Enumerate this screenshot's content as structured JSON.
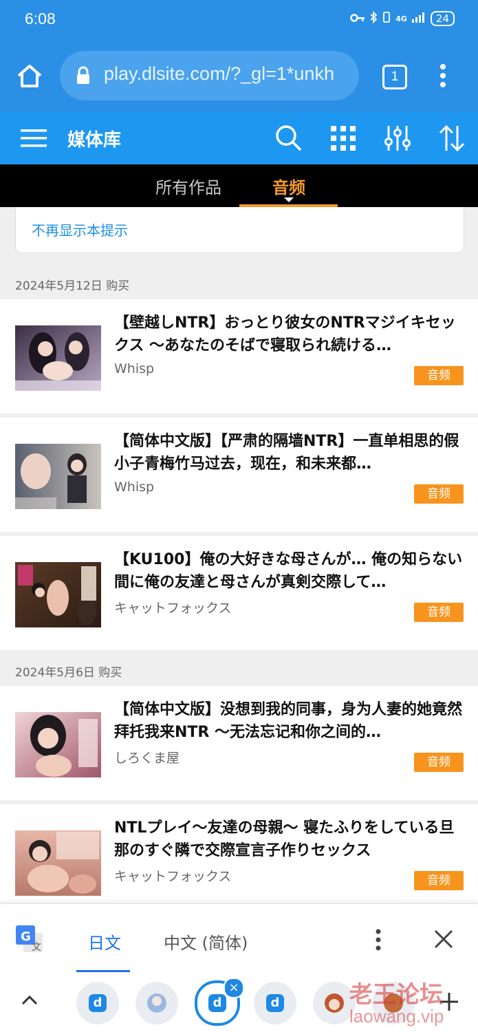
{
  "status_bar": {
    "time": "6:08",
    "network": "4G",
    "battery": "24"
  },
  "address_bar": {
    "url": "play.dlsite.com/?_gl=1*unkh",
    "tab_count": "1"
  },
  "toolbar": {
    "title": "媒体库"
  },
  "tabs": [
    {
      "label": "所有作品",
      "active": false
    },
    {
      "label": "音频",
      "active": true
    }
  ],
  "notice": {
    "link_text": "不再显示本提示"
  },
  "groups": [
    {
      "date": "2024年5月12日 购买",
      "items": [
        {
          "title": "【壁越しNTR】おっとり彼女のNTRマジイキセックス ～あなたのそばで寝取られ続ける…",
          "author": "Whisp",
          "badge": "音频"
        },
        {
          "title": "【简体中文版】【严肃的隔墙NTR】一直单相思的假小子青梅竹马过去，现在，和未来都…",
          "author": "Whisp",
          "badge": "音频"
        },
        {
          "title": "【KU100】俺の大好きな母さんが… 俺の知らない間に俺の友達と母さんが真剣交際して…",
          "author": "キャットフォックス",
          "badge": "音频"
        }
      ]
    },
    {
      "date": "2024年5月6日 购买",
      "items": [
        {
          "title": "【简体中文版】没想到我的同事，身为人妻的她竟然拜托我来NTR ～无法忘记和你之间的…",
          "author": "しろくま屋",
          "badge": "音频"
        },
        {
          "title": "NTLプレイ～友達の母親～ 寝たふりをしている旦那のすぐ隣で交際宣言子作りセックス",
          "author": "キャットフォックス",
          "badge": "音频"
        }
      ]
    }
  ],
  "translate_bar": {
    "source_lang": "日文",
    "target_lang": "中文 (简体)"
  },
  "watermark": {
    "line1": "老王论坛",
    "line2": "laowang.vip"
  },
  "colors": {
    "primary": "#1e97f0",
    "status": "#2b8fe6",
    "accent": "#f7941d",
    "link": "#1a73e8"
  }
}
